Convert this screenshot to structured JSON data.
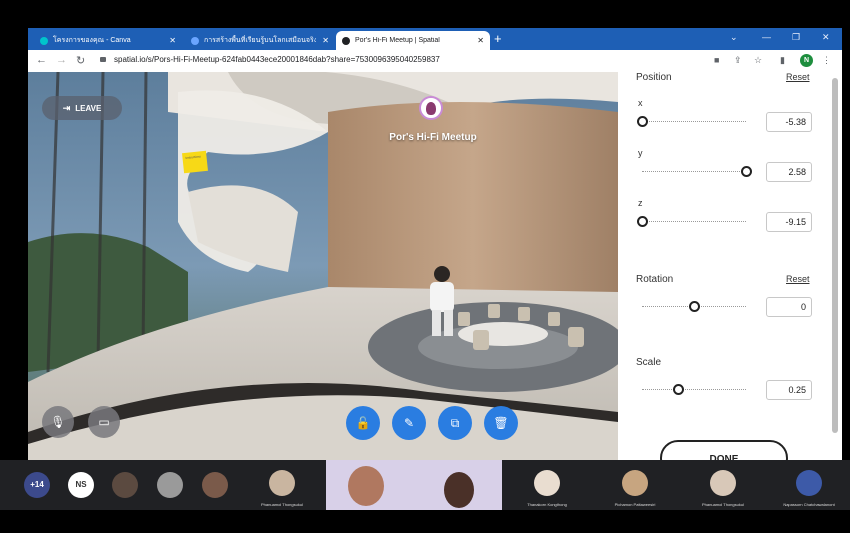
{
  "browser": {
    "tabs": [
      {
        "title": "โครงการของคุณ - Canva",
        "active": false
      },
      {
        "title": "การสร้างพื้นที่เรียนรู้บนโลกเสมือนจริง",
        "active": false
      },
      {
        "title": "Por's Hi-Fi Meetup | Spatial",
        "active": true
      }
    ],
    "url": "spatial.io/s/Pors-Hi-Fi-Meetup-624fab0443ece20001846dab?share=7530096395040259837",
    "profile_initial": "N"
  },
  "scene": {
    "leave_label": "LEAVE",
    "room_name": "Por's Hi-Fi Meetup",
    "sticky_note_text": "Instructions"
  },
  "panel": {
    "position_title": "Position",
    "rotation_title": "Rotation",
    "scale_title": "Scale",
    "reset_label": "Reset",
    "x": {
      "label": "x",
      "value": "-5.38",
      "slider": 0.0
    },
    "y": {
      "label": "y",
      "value": "2.58",
      "slider": 1.0
    },
    "z": {
      "label": "z",
      "value": "-9.15",
      "slider": 0.0
    },
    "rotation": {
      "value": "0",
      "slider": 0.5
    },
    "scale": {
      "value": "0.25",
      "slider": 0.35
    },
    "done_label": "DONE"
  },
  "participants": {
    "overflow_count": "+14",
    "ns_initials": "NS",
    "names": [
      "Phanuamol Thongsukul",
      "Thanakorn Kongthong",
      "Pichamon Pattaweesiri",
      "Phanuamol Thongsukul",
      "Napassorn Chatchawalanont"
    ],
    "colors": {
      "ns_badge": "#ffffff",
      "overflow_badge": "#3c4a8c"
    }
  }
}
